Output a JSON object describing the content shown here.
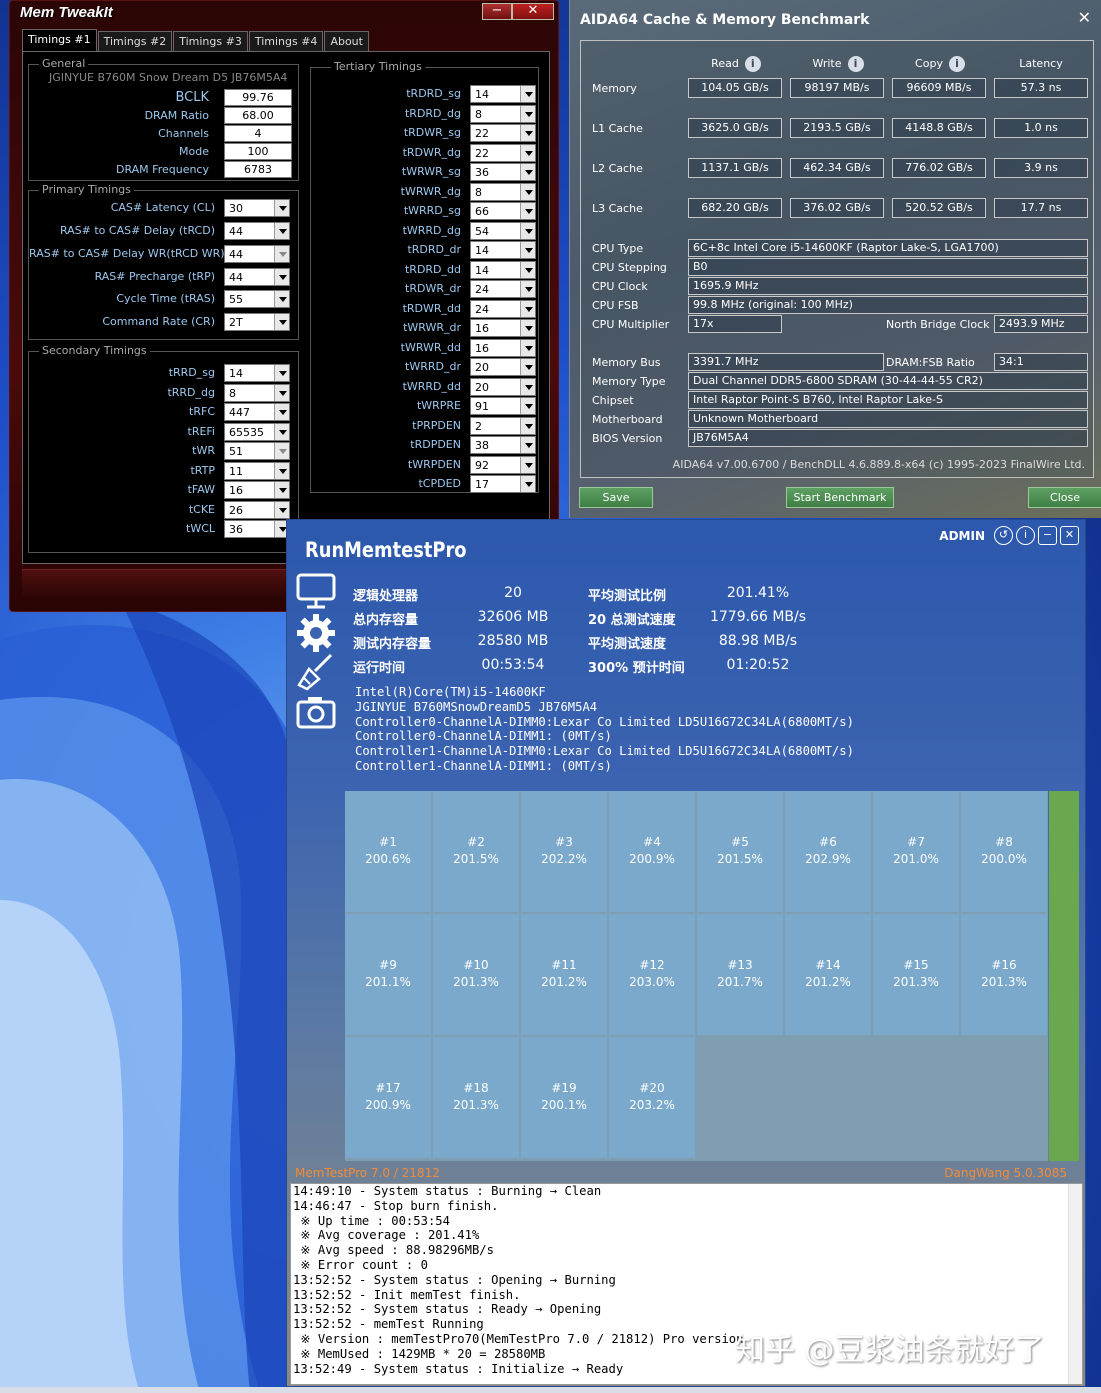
{
  "memtweakit": {
    "title": "Mem TweakIt",
    "tabs": [
      "Timings #1",
      "Timings #2",
      "Timings #3",
      "Timings #4",
      "About"
    ],
    "general": {
      "group_title": "General",
      "board": "JGINYUE B760M Snow Dream D5 JB76M5A4",
      "fields": [
        {
          "label": "BCLK",
          "value": "99.76"
        },
        {
          "label": "DRAM Ratio",
          "value": "68.00"
        },
        {
          "label": "Channels",
          "value": "4"
        },
        {
          "label": "Mode",
          "value": "100"
        },
        {
          "label": "DRAM Frequency",
          "value": "6783"
        }
      ]
    },
    "primary": {
      "group_title": "Primary Timings",
      "fields": [
        {
          "label": "CAS# Latency (CL)",
          "value": "30"
        },
        {
          "label": "RAS# to CAS# Delay (tRCD)",
          "value": "44"
        },
        {
          "label": "RAS# to CAS# Delay WR(tRCD WR)",
          "value": "44"
        },
        {
          "label": "RAS# Precharge (tRP)",
          "value": "44"
        },
        {
          "label": "Cycle Time (tRAS)",
          "value": "55"
        },
        {
          "label": "Command Rate (CR)",
          "value": "2T"
        }
      ]
    },
    "secondary": {
      "group_title": "Secondary Timings",
      "fields": [
        {
          "label": "tRRD_sg",
          "value": "14"
        },
        {
          "label": "tRRD_dg",
          "value": "8"
        },
        {
          "label": "tRFC",
          "value": "447"
        },
        {
          "label": "tREFi",
          "value": "65535"
        },
        {
          "label": "tWR",
          "value": "51"
        },
        {
          "label": "tRTP",
          "value": "11"
        },
        {
          "label": "tFAW",
          "value": "16"
        },
        {
          "label": "tCKE",
          "value": "26"
        },
        {
          "label": "tWCL",
          "value": "36"
        }
      ]
    },
    "tertiary": {
      "group_title": "Tertiary Timings",
      "fields": [
        {
          "label": "tRDRD_sg",
          "value": "14"
        },
        {
          "label": "tRDRD_dg",
          "value": "8"
        },
        {
          "label": "tRDWR_sg",
          "value": "22"
        },
        {
          "label": "tRDWR_dg",
          "value": "22"
        },
        {
          "label": "tWRWR_sg",
          "value": "36"
        },
        {
          "label": "tWRWR_dg",
          "value": "8"
        },
        {
          "label": "tWRRD_sg",
          "value": "66"
        },
        {
          "label": "tWRRD_dg",
          "value": "54"
        },
        {
          "label": "tRDRD_dr",
          "value": "14"
        },
        {
          "label": "tRDRD_dd",
          "value": "14"
        },
        {
          "label": "tRDWR_dr",
          "value": "24"
        },
        {
          "label": "tRDWR_dd",
          "value": "24"
        },
        {
          "label": "tWRWR_dr",
          "value": "16"
        },
        {
          "label": "tWRWR_dd",
          "value": "16"
        },
        {
          "label": "tWRRD_dr",
          "value": "20"
        },
        {
          "label": "tWRRD_dd",
          "value": "20"
        },
        {
          "label": "tWRPRE",
          "value": "91"
        },
        {
          "label": "tPRPDEN",
          "value": "2"
        },
        {
          "label": "tRDPDEN",
          "value": "38"
        },
        {
          "label": "tWRPDEN",
          "value": "92"
        },
        {
          "label": "tCPDED",
          "value": "17"
        }
      ]
    }
  },
  "aida": {
    "title": "AIDA64 Cache & Memory Benchmark",
    "columns": [
      "Read",
      "Write",
      "Copy",
      "Latency"
    ],
    "rows": [
      {
        "label": "Memory",
        "values": [
          "104.05 GB/s",
          "98197 MB/s",
          "96609 MB/s",
          "57.3 ns"
        ]
      },
      {
        "label": "L1 Cache",
        "values": [
          "3625.0 GB/s",
          "2193.5 GB/s",
          "4148.8 GB/s",
          "1.0 ns"
        ]
      },
      {
        "label": "L2 Cache",
        "values": [
          "1137.1 GB/s",
          "462.34 GB/s",
          "776.02 GB/s",
          "3.9 ns"
        ]
      },
      {
        "label": "L3 Cache",
        "values": [
          "682.20 GB/s",
          "376.02 GB/s",
          "520.52 GB/s",
          "17.7 ns"
        ]
      }
    ],
    "cpu": [
      {
        "label": "CPU Type",
        "value": "6C+8c Intel Core i5-14600KF  (Raptor Lake-S, LGA1700)"
      },
      {
        "label": "CPU Stepping",
        "value": "B0"
      },
      {
        "label": "CPU Clock",
        "value": "1695.9 MHz"
      },
      {
        "label": "CPU FSB",
        "value": "99.8 MHz  (original: 100 MHz)"
      }
    ],
    "cpu_multiplier": {
      "label": "CPU Multiplier",
      "value": "17x",
      "nb_label": "North Bridge Clock",
      "nb_value": "2493.9 MHz"
    },
    "memory_bus": {
      "label": "Memory Bus",
      "value": "3391.7 MHz",
      "ratio_label": "DRAM:FSB Ratio",
      "ratio_value": "34:1"
    },
    "system": [
      {
        "label": "Memory Type",
        "value": "Dual Channel DDR5-6800 SDRAM  (30-44-44-55 CR2)"
      },
      {
        "label": "Chipset",
        "value": "Intel Raptor Point-S B760, Intel Raptor Lake-S"
      },
      {
        "label": "Motherboard",
        "value": "Unknown Motherboard"
      },
      {
        "label": "BIOS Version",
        "value": "JB76M5A4"
      }
    ],
    "footer": "AIDA64 v7.00.6700 / BenchDLL 4.6.889.8-x64  (c) 1995-2023 FinalWire Ltd.",
    "buttons": {
      "save": "Save",
      "start": "Start Benchmark",
      "close": "Close"
    }
  },
  "rmt": {
    "title": "RunMemtestPro",
    "admin": "ADMIN",
    "stats_left": [
      {
        "label": "逻辑处理器",
        "value": "20"
      },
      {
        "label": "总内存容量",
        "value": "32606 MB"
      },
      {
        "label": "测试内存容量",
        "value": "28580 MB"
      },
      {
        "label": "运行时间",
        "value": "00:53:54"
      }
    ],
    "stats_right": [
      {
        "label": "平均测试比例",
        "value": "201.41%"
      },
      {
        "label": "20 总测试速度",
        "value": "1779.66 MB/s"
      },
      {
        "label": "平均测试速度",
        "value": "88.98 MB/s"
      },
      {
        "label": "300% 预计时间",
        "value": "01:20:52"
      }
    ],
    "sysinfo": [
      "Intel(R)Core(TM)i5-14600KF",
      "JGINYUE B760MSnowDreamD5 JB76M5A4",
      "Controller0-ChannelA-DIMM0:Lexar Co Limited LD5U16G72C34LA(6800MT/s)",
      "Controller0-ChannelA-DIMM1: (0MT/s)",
      "Controller1-ChannelA-DIMM0:Lexar Co Limited LD5U16G72C34LA(6800MT/s)",
      "Controller1-ChannelA-DIMM1: (0MT/s)"
    ],
    "cells": [
      {
        "id": "#1",
        "pct": "200.6%"
      },
      {
        "id": "#2",
        "pct": "201.5%"
      },
      {
        "id": "#3",
        "pct": "202.2%"
      },
      {
        "id": "#4",
        "pct": "200.9%"
      },
      {
        "id": "#5",
        "pct": "201.5%"
      },
      {
        "id": "#6",
        "pct": "202.9%"
      },
      {
        "id": "#7",
        "pct": "201.0%"
      },
      {
        "id": "#8",
        "pct": "200.0%"
      },
      {
        "id": "#9",
        "pct": "201.1%"
      },
      {
        "id": "#10",
        "pct": "201.3%"
      },
      {
        "id": "#11",
        "pct": "201.2%"
      },
      {
        "id": "#12",
        "pct": "203.0%"
      },
      {
        "id": "#13",
        "pct": "201.7%"
      },
      {
        "id": "#14",
        "pct": "201.2%"
      },
      {
        "id": "#15",
        "pct": "201.3%"
      },
      {
        "id": "#16",
        "pct": "201.3%"
      },
      {
        "id": "#17",
        "pct": "200.9%"
      },
      {
        "id": "#18",
        "pct": "201.3%"
      },
      {
        "id": "#19",
        "pct": "200.1%"
      },
      {
        "id": "#20",
        "pct": "203.2%"
      }
    ],
    "footer_left": "MemTestPro 7.0 / 21812",
    "footer_right": "DangWang 5.0.3085",
    "log": [
      "14:49:10 - System status : Burning → Clean",
      "14:46:47 - Stop burn finish.",
      " ※ Up time : 00:53:54",
      " ※ Avg coverage : 201.41%",
      " ※ Avg speed : 88.98296MB/s",
      " ※ Error count : 0",
      "13:52:52 - System status : Opening → Burning",
      "13:52:52 - Init memTest finish.",
      "13:52:52 - System status : Ready → Opening",
      "13:52:52 - memTest Running",
      " ※ Version : memTestPro70(MemTestPro 7.0 / 21812) Pro version",
      " ※ MemUsed : 1429MB * 20 = 28580MB",
      "13:52:49 - System status : Initialize → Ready"
    ]
  },
  "watermark": "知乎 @豆浆油条就好了",
  "icons": [
    "monitor-icon",
    "gear-icon",
    "broom-icon",
    "camera-icon",
    "history-icon",
    "info-icon",
    "minimize-icon",
    "close-icon"
  ]
}
